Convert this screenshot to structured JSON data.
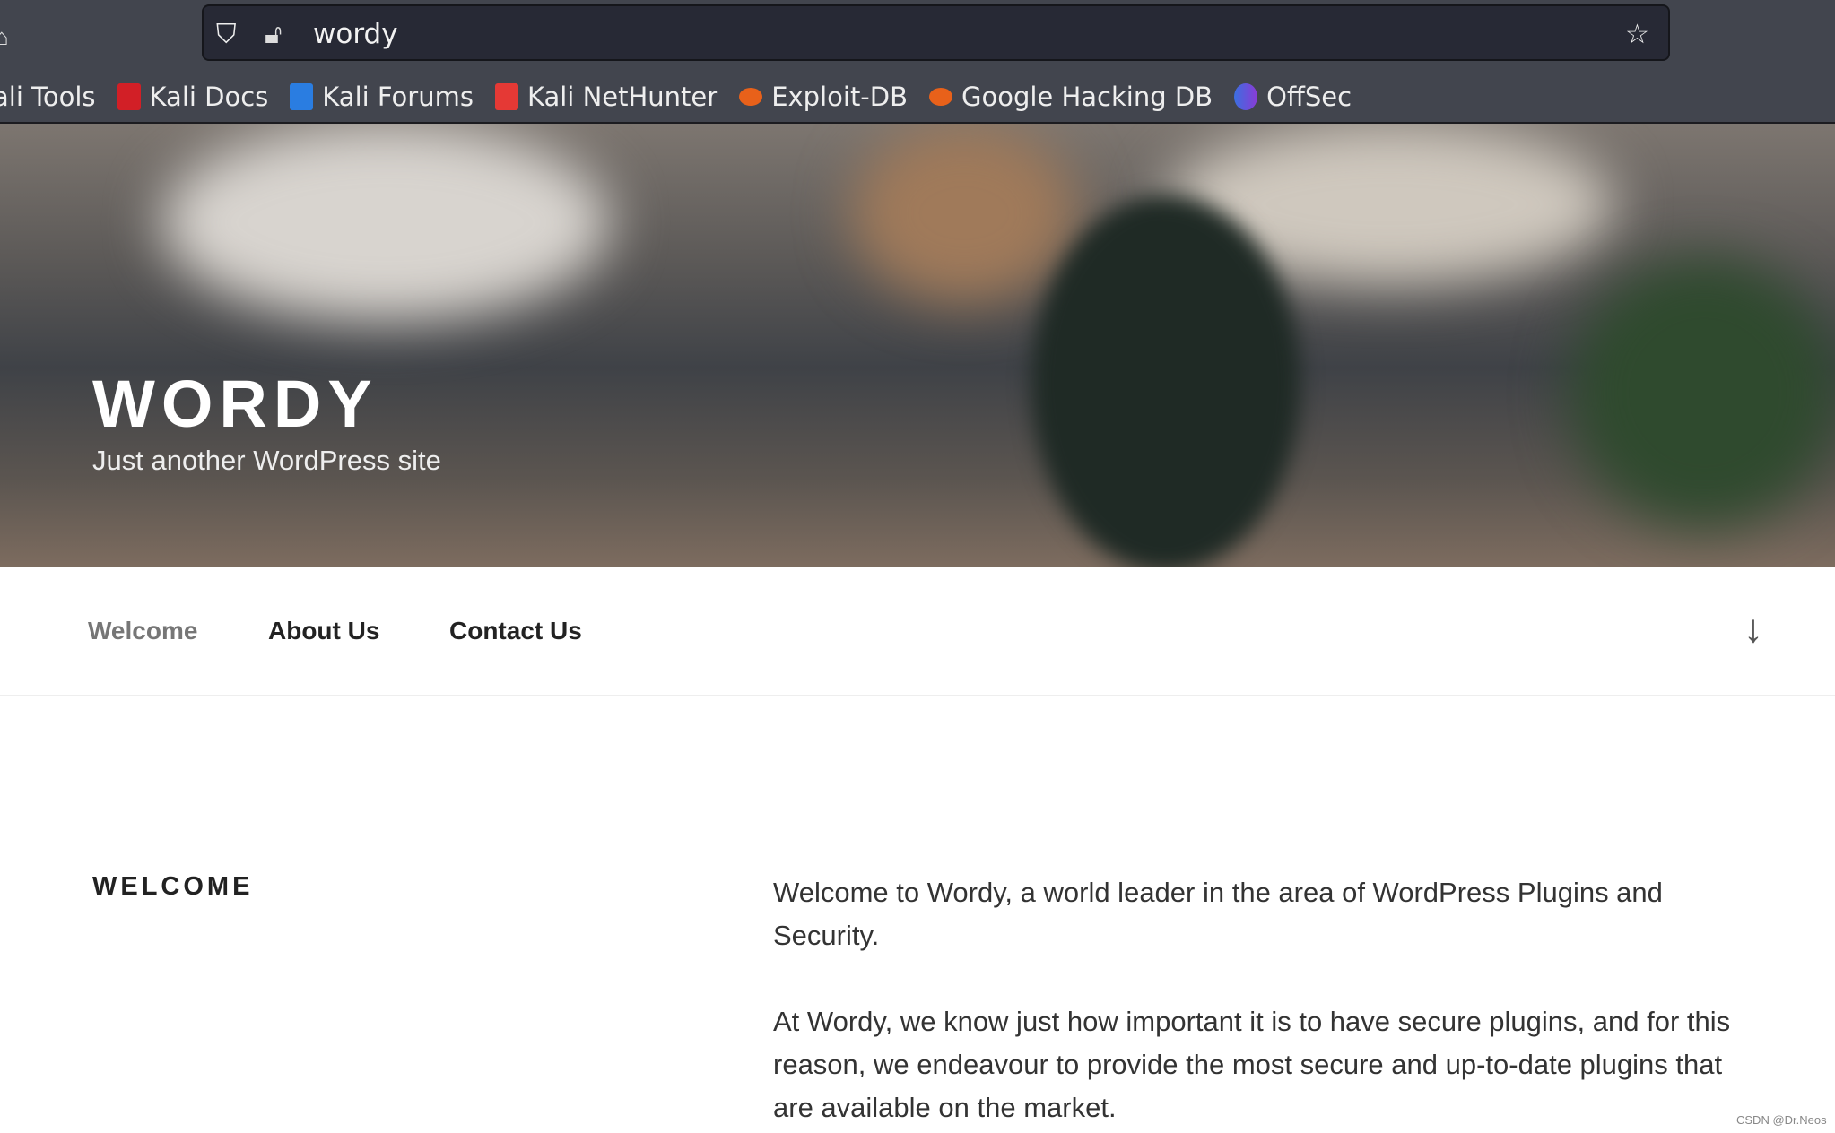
{
  "browser": {
    "url": "wordy",
    "bookmarks": [
      {
        "label": "ali Tools",
        "color": ""
      },
      {
        "label": "Kali Docs",
        "color": "#d21f26"
      },
      {
        "label": "Kali Forums",
        "color": "#2a7de1"
      },
      {
        "label": "Kali NetHunter",
        "color": "#e53935"
      },
      {
        "label": "Exploit-DB",
        "color": "#e8611a"
      },
      {
        "label": "Google Hacking DB",
        "color": "#e8611a"
      },
      {
        "label": "OffSec",
        "color": "#5c4bd6"
      }
    ]
  },
  "site": {
    "title": "WORDY",
    "tagline": "Just another WordPress site"
  },
  "nav": {
    "items": [
      "Welcome",
      "About Us",
      "Contact Us"
    ]
  },
  "content": {
    "heading": "WELCOME",
    "paragraphs": [
      "Welcome to Wordy, a world leader in the area of WordPress Plugins and Security.",
      "At Wordy, we know just how important it is to have secure plugins, and for this reason, we endeavour to provide the most secure and up-to-date plugins that are available on the market."
    ]
  },
  "watermark": "CSDN @Dr.Neos"
}
